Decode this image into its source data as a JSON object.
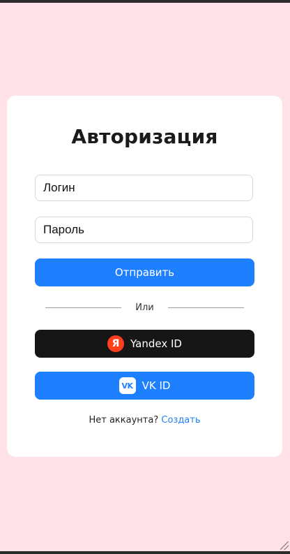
{
  "auth": {
    "title": "Авторизация",
    "login_placeholder": "Логин",
    "password_placeholder": "Пароль",
    "submit_label": "Отправить",
    "divider_text": "Или",
    "yandex_label": "Yandex ID",
    "yandex_icon_glyph": "Я",
    "vk_label": "VK ID",
    "vk_icon_glyph": "VK",
    "no_account_text": "Нет аккаунта?",
    "create_link": "Создать"
  },
  "colors": {
    "page_background": "#ffe1e7",
    "accent_blue": "#1f80ff",
    "yandex_button": "#161616",
    "yandex_red": "#fc3f1d"
  },
  "icons": {
    "yandex": "yandex-logo-icon",
    "vk": "vk-logo-icon"
  }
}
